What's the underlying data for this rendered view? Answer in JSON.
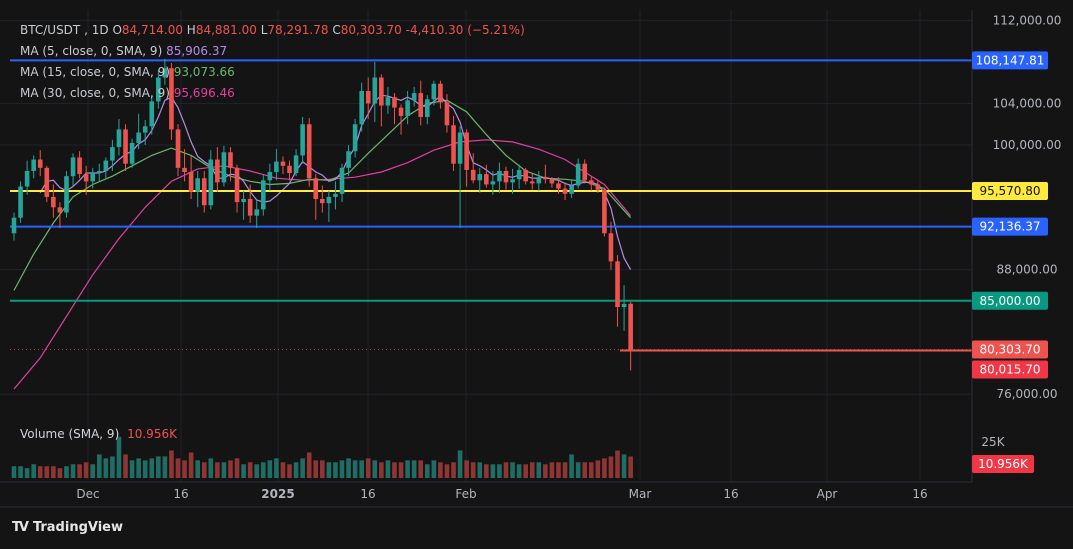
{
  "header": {
    "symbol": "BTC/USDT",
    "interval": "1D",
    "open_label": "O",
    "open": "84,714.00",
    "high_label": "H",
    "high": "84,881.00",
    "low_label": "L",
    "low": "78,291.78",
    "close_label": "C",
    "close": "80,303.70",
    "change": "-4,410.30 (−5.21%)"
  },
  "indicators": [
    {
      "label": "MA (5, close, 0, SMA, 9)",
      "value": "85,906.37",
      "color": "#b48ce8"
    },
    {
      "label": "MA (15, close, 0, SMA, 9)",
      "value": "93,073.66",
      "color": "#66bb6a"
    },
    {
      "label": "MA (30, close, 0, SMA, 9)",
      "value": "95,696.46",
      "color": "#e040a0"
    }
  ],
  "volume": {
    "label": "Volume (SMA, 9)",
    "value": "10.956K",
    "axis_tick": "25K",
    "badge": "10.956K"
  },
  "logo_text": "TradingView",
  "colors": {
    "up": "#26a69a",
    "down": "#ef5350",
    "background": "#141414"
  },
  "chart_data": {
    "type": "candlestick",
    "ylim": [
      74000,
      113000
    ],
    "y_ticks": [
      {
        "value": 112000,
        "label": "112,000.00"
      },
      {
        "value": 104000,
        "label": "104,000.00"
      },
      {
        "value": 100000,
        "label": "100,000.00"
      },
      {
        "value": 88000,
        "label": "88,000.00"
      },
      {
        "value": 76000,
        "label": "76,000.00"
      }
    ],
    "x_ticks": [
      "Dec",
      "16",
      "2025",
      "16",
      "Feb",
      "Mar",
      "16",
      "Apr",
      "16"
    ],
    "x_tick_bold": [
      false,
      false,
      true,
      false,
      false,
      false,
      false,
      false,
      false
    ],
    "horizontal_lines": [
      {
        "value": 108147.81,
        "label": "108,147.81",
        "color": "#2962ff"
      },
      {
        "value": 95570.8,
        "label": "95,570.80",
        "color": "#ffeb3b"
      },
      {
        "value": 92136.37,
        "label": "92,136.37",
        "color": "#2962ff"
      },
      {
        "value": 85000.0,
        "label": "85,000.00",
        "color": "#089981"
      }
    ],
    "last_price": {
      "value": 80303.7,
      "label": "80,303.70",
      "color": "#ef5350"
    },
    "low_marker": {
      "value": 80015.7,
      "label": "80,015.70",
      "color": "#f23645"
    },
    "candles": [
      [
        91500,
        93500,
        90800,
        93000
      ],
      [
        93000,
        96500,
        92500,
        96000
      ],
      [
        96000,
        98500,
        95200,
        97500
      ],
      [
        97500,
        99000,
        96800,
        98600
      ],
      [
        98600,
        99500,
        97000,
        97800
      ],
      [
        97800,
        98000,
        94500,
        95000
      ],
      [
        95000,
        96200,
        93000,
        94000
      ],
      [
        94000,
        94500,
        92000,
        93500
      ],
      [
        93500,
        97500,
        93000,
        97000
      ],
      [
        97000,
        99200,
        96000,
        98800
      ],
      [
        98800,
        99400,
        96800,
        97200
      ],
      [
        97200,
        98000,
        95200,
        96500
      ],
      [
        96500,
        97800,
        95800,
        97300
      ],
      [
        97300,
        98200,
        96500,
        97500
      ],
      [
        97500,
        98800,
        96800,
        98500
      ],
      [
        98500,
        100500,
        97500,
        99800
      ],
      [
        99800,
        102500,
        99000,
        101500
      ],
      [
        101500,
        102000,
        97500,
        98200
      ],
      [
        98200,
        100600,
        97800,
        100200
      ],
      [
        100200,
        103000,
        99600,
        101200
      ],
      [
        101200,
        102400,
        100000,
        101800
      ],
      [
        101800,
        104800,
        101000,
        104200
      ],
      [
        104200,
        107200,
        103500,
        106500
      ],
      [
        106500,
        108300,
        105800,
        107400
      ],
      [
        107400,
        107900,
        100500,
        101500
      ],
      [
        101500,
        102000,
        97000,
        97800
      ],
      [
        97800,
        99600,
        96500,
        97400
      ],
      [
        97400,
        99000,
        94800,
        95500
      ],
      [
        95500,
        97500,
        94000,
        96800
      ],
      [
        96800,
        97500,
        93500,
        94200
      ],
      [
        94200,
        99500,
        93800,
        98600
      ],
      [
        98600,
        99800,
        95500,
        96400
      ],
      [
        96400,
        99900,
        96000,
        99300
      ],
      [
        99300,
        99800,
        96500,
        97800
      ],
      [
        97800,
        98100,
        93500,
        94500
      ],
      [
        94500,
        95600,
        92800,
        94800
      ],
      [
        94800,
        96200,
        92500,
        93200
      ],
      [
        93200,
        94700,
        92000,
        93800
      ],
      [
        93800,
        97200,
        93200,
        96600
      ],
      [
        96600,
        98200,
        95600,
        97400
      ],
      [
        97400,
        99600,
        96600,
        98400
      ],
      [
        98400,
        98900,
        97200,
        98000
      ],
      [
        98000,
        98500,
        96600,
        97300
      ],
      [
        97300,
        99600,
        97000,
        99000
      ],
      [
        99000,
        102700,
        98200,
        102000
      ],
      [
        102000,
        102600,
        96000,
        96800
      ],
      [
        96800,
        97200,
        92800,
        94800
      ],
      [
        94800,
        96100,
        93500,
        94400
      ],
      [
        94400,
        95600,
        92600,
        95000
      ],
      [
        95000,
        96500,
        93800,
        95300
      ],
      [
        95300,
        98200,
        94500,
        97800
      ],
      [
        97800,
        100000,
        97000,
        99400
      ],
      [
        99400,
        102500,
        98800,
        102000
      ],
      [
        102000,
        106000,
        101300,
        105200
      ],
      [
        105200,
        106500,
        102500,
        104000
      ],
      [
        104000,
        108000,
        102200,
        106500
      ],
      [
        106500,
        106800,
        101800,
        103800
      ],
      [
        103800,
        105600,
        103000,
        104600
      ],
      [
        104600,
        105000,
        102000,
        103600
      ],
      [
        103600,
        103900,
        101000,
        102800
      ],
      [
        102800,
        105200,
        102000,
        104300
      ],
      [
        104300,
        105600,
        103700,
        105000
      ],
      [
        105000,
        106200,
        101900,
        102700
      ],
      [
        102700,
        104800,
        102000,
        104400
      ],
      [
        104400,
        106200,
        103800,
        105900
      ],
      [
        105900,
        106200,
        103500,
        104100
      ],
      [
        104100,
        104900,
        101200,
        101900
      ],
      [
        101900,
        102800,
        97500,
        98200
      ],
      [
        98200,
        101800,
        92000,
        101200
      ],
      [
        101200,
        101500,
        96000,
        97600
      ],
      [
        97600,
        99200,
        96300,
        96600
      ],
      [
        96600,
        97800,
        95400,
        97200
      ],
      [
        97200,
        98100,
        95900,
        96200
      ],
      [
        96200,
        97500,
        95200,
        96500
      ],
      [
        96500,
        98300,
        95400,
        97500
      ],
      [
        97500,
        97900,
        95700,
        96400
      ],
      [
        96400,
        97700,
        95300,
        96700
      ],
      [
        96700,
        98100,
        95800,
        97600
      ],
      [
        97600,
        97800,
        96200,
        96500
      ],
      [
        96500,
        97300,
        95700,
        96300
      ],
      [
        96300,
        97500,
        95600,
        96900
      ],
      [
        96900,
        98100,
        96300,
        96700
      ],
      [
        96700,
        96900,
        95900,
        96300
      ],
      [
        96300,
        96900,
        95300,
        95800
      ],
      [
        95800,
        96400,
        94700,
        95300
      ],
      [
        95300,
        96600,
        94900,
        96100
      ],
      [
        96100,
        98700,
        95800,
        98200
      ],
      [
        98200,
        98600,
        96300,
        96600
      ],
      [
        96600,
        97000,
        95600,
        96200
      ],
      [
        96200,
        96600,
        95400,
        95700
      ],
      [
        95700,
        95900,
        91200,
        91500
      ],
      [
        91500,
        92600,
        88000,
        88800
      ],
      [
        88800,
        89400,
        82500,
        84400
      ],
      [
        84400,
        86500,
        82100,
        84700
      ],
      [
        84714,
        84881,
        78291.78,
        80303.7
      ]
    ],
    "volume": [
      6,
      6,
      5,
      7,
      6,
      6,
      6,
      5,
      6,
      7,
      7,
      8,
      7,
      12,
      10,
      11,
      21,
      12,
      9,
      10,
      9,
      10,
      11,
      11,
      14,
      10,
      9,
      13,
      9,
      8,
      10,
      8,
      8,
      9,
      10,
      7,
      8,
      7,
      8,
      9,
      10,
      8,
      7,
      8,
      10,
      13,
      9,
      9,
      8,
      8,
      9,
      10,
      9,
      9,
      10,
      9,
      8,
      9,
      8,
      8,
      9,
      9,
      9,
      7,
      9,
      8,
      7,
      8,
      14,
      9,
      8,
      8,
      7,
      7,
      7,
      8,
      8,
      7,
      7,
      8,
      8,
      7,
      8,
      8,
      8,
      12,
      8,
      8,
      8,
      9,
      10,
      11,
      14,
      12,
      10.956
    ],
    "ma5": [
      null,
      null,
      null,
      null,
      95400,
      96500,
      96600,
      95900,
      95600,
      96000,
      96600,
      97300,
      97300,
      97300,
      97500,
      98000,
      98600,
      99100,
      99400,
      100100,
      100500,
      101400,
      102700,
      104300,
      104600,
      103600,
      102000,
      100300,
      98900,
      98400,
      98000,
      96800,
      96800,
      97200,
      97100,
      96500,
      95500,
      94700,
      94500,
      94600,
      95100,
      95700,
      96300,
      97500,
      98400,
      97900,
      97400,
      97100,
      96500,
      96700,
      97400,
      98800,
      99800,
      101900,
      103000,
      104200,
      104800,
      104700,
      104500,
      104300,
      104600,
      104300,
      103800,
      103700,
      104200,
      104700,
      104000,
      103500,
      102200,
      100000,
      98300,
      98000,
      97600,
      97100,
      97300,
      97000,
      96900,
      97100,
      97000,
      96800,
      96800,
      96900,
      96700,
      96600,
      96300,
      96100,
      96300,
      96400,
      96400,
      96200,
      95400,
      93900,
      91200,
      89100,
      88000
    ],
    "ma15": [
      null,
      null,
      null,
      null,
      null,
      null,
      null,
      null,
      null,
      null,
      null,
      null,
      null,
      null,
      null,
      null,
      null,
      null,
      null,
      null,
      null,
      null,
      null,
      null,
      null,
      null,
      null,
      null,
      null,
      null,
      null,
      null,
      null,
      null,
      null,
      null,
      null,
      null,
      null,
      null,
      null,
      null,
      null,
      null,
      null,
      null,
      null,
      null,
      null,
      null,
      null,
      null,
      null,
      null,
      null,
      null,
      null,
      null,
      null,
      null,
      null,
      null,
      null,
      null,
      null,
      null,
      null,
      null,
      null,
      null,
      null,
      null,
      null,
      null,
      null,
      null,
      null,
      null,
      null,
      null,
      null,
      null,
      null,
      null,
      null,
      null,
      null,
      null,
      null,
      null,
      null,
      null,
      null,
      null,
      null
    ],
    "ma15_points": [
      [
        0,
        86000
      ],
      [
        3,
        89500
      ],
      [
        6,
        92500
      ],
      [
        9,
        95000
      ],
      [
        12,
        96200
      ],
      [
        15,
        97000
      ],
      [
        18,
        98000
      ],
      [
        21,
        99000
      ],
      [
        24,
        99700
      ],
      [
        27,
        99000
      ],
      [
        30,
        97800
      ],
      [
        33,
        97000
      ],
      [
        36,
        96500
      ],
      [
        39,
        96200
      ],
      [
        42,
        96300
      ],
      [
        45,
        96700
      ],
      [
        48,
        96600
      ],
      [
        51,
        97300
      ],
      [
        54,
        99200
      ],
      [
        57,
        101000
      ],
      [
        60,
        102800
      ],
      [
        63,
        104000
      ],
      [
        66,
        104300
      ],
      [
        69,
        103200
      ],
      [
        72,
        101000
      ],
      [
        75,
        99000
      ],
      [
        78,
        97500
      ],
      [
        81,
        96800
      ],
      [
        84,
        96700
      ],
      [
        87,
        96500
      ],
      [
        90,
        95800
      ],
      [
        94,
        93000
      ]
    ],
    "ma30_points": [
      [
        0,
        76500
      ],
      [
        4,
        79500
      ],
      [
        8,
        83500
      ],
      [
        12,
        87500
      ],
      [
        16,
        91000
      ],
      [
        20,
        94000
      ],
      [
        24,
        96500
      ],
      [
        28,
        97700
      ],
      [
        32,
        98000
      ],
      [
        36,
        97500
      ],
      [
        40,
        96800
      ],
      [
        44,
        96600
      ],
      [
        48,
        96700
      ],
      [
        52,
        96900
      ],
      [
        56,
        97400
      ],
      [
        60,
        98300
      ],
      [
        64,
        99500
      ],
      [
        68,
        100300
      ],
      [
        72,
        100500
      ],
      [
        76,
        100300
      ],
      [
        80,
        99600
      ],
      [
        84,
        98600
      ],
      [
        87,
        97400
      ],
      [
        90,
        96200
      ],
      [
        94,
        93200
      ]
    ]
  }
}
